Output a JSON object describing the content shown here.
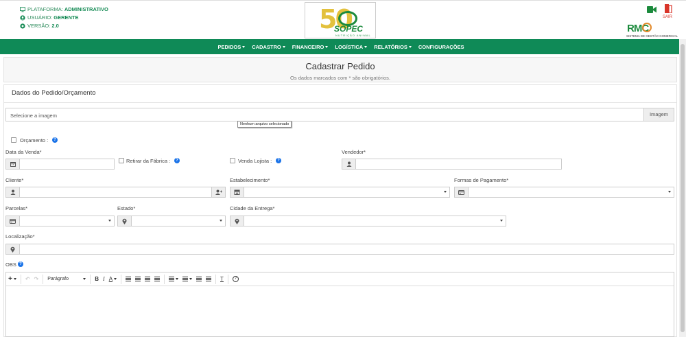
{
  "header": {
    "platform_label": "PLATAFORMA:",
    "platform_value": "ADMINISTRATIVO",
    "user_label": "USUÁRIO:",
    "user_value": "GERENTE",
    "version_label": "VERSÃO:",
    "version_value": "2.0",
    "logo_number": "50",
    "logo_name": "SOPEC",
    "logo_tagline": "NUTRIÇÃO ANIMAL",
    "logout_label": "SAIR",
    "rmc_logo": "RMC",
    "rmc_tagline": "SISTEMA DE GESTÃO COMERCIAL"
  },
  "nav": {
    "items": [
      "PEDIDOS",
      "CADASTRO",
      "FINANCEIRO",
      "LOGÍSTICA",
      "RELATÓRIOS",
      "CONFIGURAÇÕES"
    ]
  },
  "page": {
    "title": "Cadastrar Pedido",
    "subtitle": "Os dados marcados com * são obrigatórios."
  },
  "form": {
    "section_title": "Dados do Pedido/Orçamento",
    "image_placeholder": "Selecione a imagem",
    "image_button": "Imagem",
    "image_tooltip": "Nenhum arquivo selecionado",
    "orcamento_label": "Orçamento :",
    "data_venda_label": "Data da Venda*",
    "retirar_label": "Retirar da Fábrica :",
    "venda_lojista_label": "Venda Lojista :",
    "vendedor_label": "Vendedor*",
    "cliente_label": "Cliente*",
    "estabelecimento_label": "Estabelecimento*",
    "formas_pagamento_label": "Formas de Pagamento*",
    "parcelas_label": "Parcelas*",
    "estado_label": "Estado*",
    "cidade_label": "Cidade da Entrega*",
    "localizacao_label": "Localização*",
    "obs_label": "OBS"
  },
  "editor": {
    "paragraph_label": "Parágrafo",
    "bold": "B",
    "italic": "I",
    "font_color": "A",
    "clear_format": "T",
    "help": "?"
  },
  "colors": {
    "brand_green": "#0f8a57",
    "help_blue": "#1a73e8",
    "logout_red": "#d9352a"
  }
}
